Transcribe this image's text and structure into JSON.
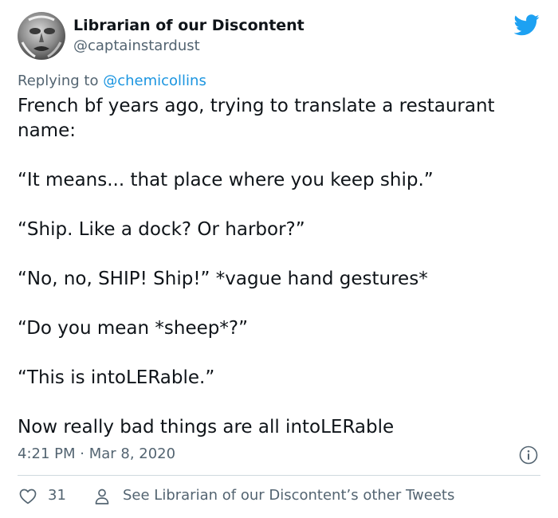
{
  "author": {
    "display_name": "Librarian of our Discontent",
    "handle": "@captainstardust"
  },
  "reply_context": {
    "prefix": "Replying to",
    "mention": "@chemicollins"
  },
  "tweet": {
    "paragraphs": [
      "French bf years ago, trying to translate a restaurant name:",
      "“It means... that place where you keep ship.”",
      "“Ship. Like a dock? Or harbor?”",
      "“No, no, SHIP! Ship!” *vague hand gestures*",
      "“Do you mean *sheep*?”",
      "“This is intoLERable.”",
      "Now really bad things are all intoLERable"
    ],
    "timestamp": "4:21 PM · Mar 8, 2020"
  },
  "footer": {
    "like_count": "31",
    "other_tweets_label": "See Librarian of our Discontent’s other Tweets"
  },
  "icons": {
    "brand": "twitter-bird-icon",
    "info": "info-icon",
    "like": "heart-icon",
    "profile": "person-icon"
  },
  "colors": {
    "twitter_blue": "#1da1f2",
    "link": "#1b95e0",
    "secondary_text": "#536471",
    "primary_text": "#0f1419",
    "divider": "#cfd9de"
  }
}
